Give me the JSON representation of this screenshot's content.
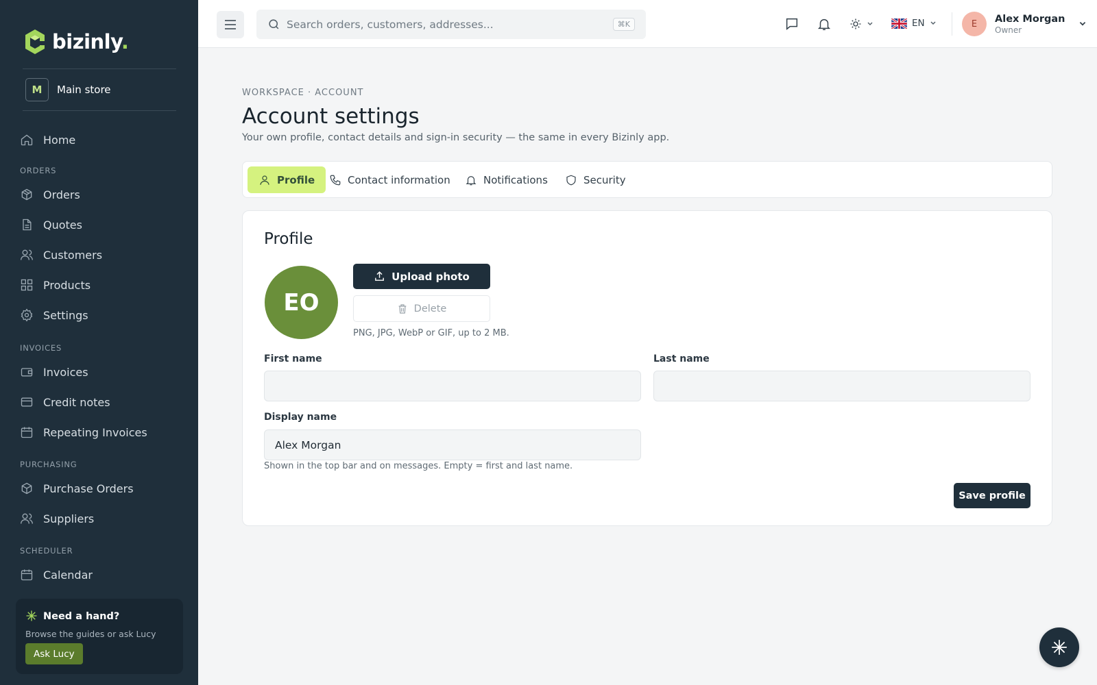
{
  "brand": {
    "name": "bizinly",
    "dot": ".",
    "accent": "#a3d65c"
  },
  "store": {
    "initial": "M",
    "name": "Main store"
  },
  "sidebar": {
    "home": "Home",
    "sections": {
      "orders": {
        "title": "ORDERS",
        "items": [
          "Orders",
          "Quotes",
          "Customers",
          "Products",
          "Settings"
        ]
      },
      "invoices": {
        "title": "INVOICES",
        "items": [
          "Invoices",
          "Credit notes",
          "Repeating Invoices"
        ]
      },
      "purchasing": {
        "title": "PURCHASING",
        "items": [
          "Purchase Orders",
          "Suppliers"
        ]
      },
      "scheduler": {
        "title": "SCHEDULER",
        "items": [
          "Calendar"
        ]
      }
    },
    "help": {
      "title": "Need a hand?",
      "subtitle": "Browse the guides or ask Lucy",
      "button": "Ask Lucy"
    }
  },
  "topbar": {
    "search_placeholder": "Search orders, customers, addresses...",
    "shortcut": "⌘K",
    "language": "EN",
    "user": {
      "initial": "E",
      "name": "Alex Morgan",
      "role": "Owner"
    }
  },
  "page": {
    "breadcrumb": "WORKSPACE · ACCOUNT",
    "title": "Account settings",
    "subtitle": "Your own profile, contact details and sign-in security — the same in every Bizinly app."
  },
  "tabs": {
    "profile": "Profile",
    "contact": "Contact information",
    "notifications": "Notifications",
    "security": "Security",
    "active": "Profile"
  },
  "profile": {
    "title": "Profile",
    "avatar_initials": "EO",
    "upload_label": "Upload photo",
    "delete_label": "Delete",
    "photo_hint": "PNG, JPG, WebP or GIF, up to 2 MB.",
    "first_name_label": "First name",
    "first_name_value": "",
    "last_name_label": "Last name",
    "last_name_value": "",
    "display_name_label": "Display name",
    "display_name_value": "Alex Morgan",
    "display_name_hint": "Shown in the top bar and on messages. Empty = first and last name.",
    "save_label": "Save profile"
  }
}
